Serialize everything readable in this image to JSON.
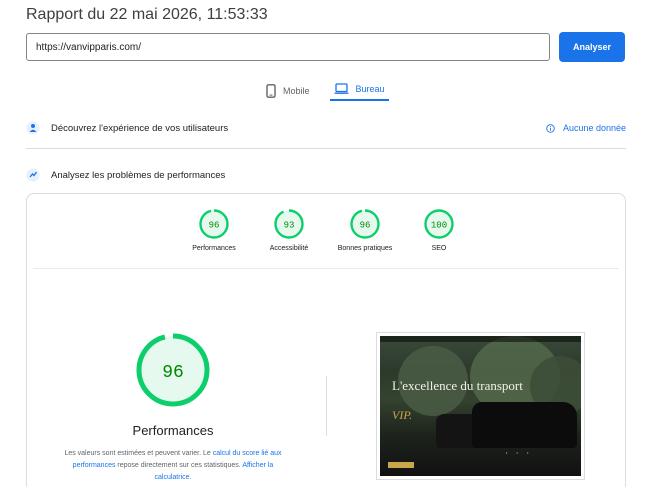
{
  "header": {
    "title": "Rapport du 22 mai 2026, 11:53:33"
  },
  "url_bar": {
    "value": "https://vanvipparis.com/",
    "button_label": "Analyser"
  },
  "tabs": [
    {
      "label": "Mobile",
      "icon": "smartphone-icon",
      "active": false
    },
    {
      "label": "Bureau",
      "icon": "desktop-icon",
      "active": true
    }
  ],
  "field_data": {
    "title": "Découvrez l'expérience de vos utilisateurs",
    "status": "Aucune donnée"
  },
  "lab_data": {
    "title": "Analysez les problèmes de performances"
  },
  "scores": [
    {
      "label": "Performances",
      "value": 96
    },
    {
      "label": "Accessibilité",
      "value": 93
    },
    {
      "label": "Bonnes pratiques",
      "value": 96
    },
    {
      "label": "SEO",
      "value": 100
    }
  ],
  "main_score": {
    "label": "Performances",
    "value": 96
  },
  "note": {
    "text_before": "Les valeurs sont estimées et peuvent varier. Le ",
    "link1": "calcul du score lié aux performances",
    "text_middle": " repose directement sur ces statistiques. ",
    "link2": "Afficher la calculatrice",
    "text_after": "."
  },
  "screenshot": {
    "headline": "L'excellence du transport",
    "accent": "VIP."
  },
  "colors": {
    "good": "#0cce6b",
    "good_fill": "#e6f9ef",
    "good_text": "#008800",
    "accent": "#1a73e8"
  }
}
